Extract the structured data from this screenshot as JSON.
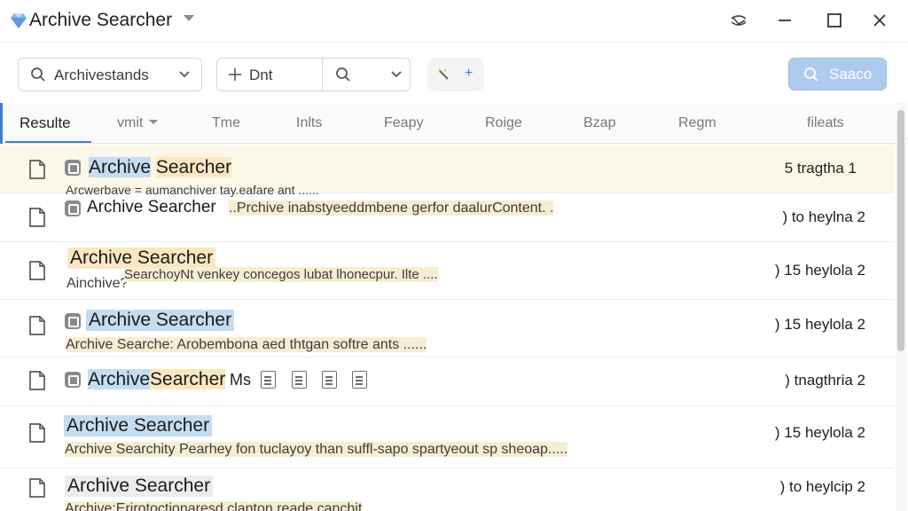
{
  "window": {
    "title": "Archive Searcher",
    "logo_icon": "diamond-logo-icon",
    "controls": [
      "sync-icon",
      "minimize-icon",
      "maximize-icon",
      "close-icon"
    ]
  },
  "toolbar": {
    "scope_field": {
      "value": "Archivestands",
      "icon": "search-icon",
      "dropdown_icon": "chevron-down-icon"
    },
    "filter_field": {
      "value": "Dnt",
      "icon": "plus-icon",
      "search_icon": "search-icon",
      "dropdown_icon": "chevron-down-icon"
    },
    "tool_chip": {
      "icon": "wand-icon",
      "plus": "+"
    },
    "search_button": {
      "label": "Saaco",
      "icon": "search-icon"
    }
  },
  "columns": [
    {
      "label": "Resulte",
      "active": true
    },
    {
      "label": "vmit",
      "dropdown": true
    },
    {
      "label": "Tme"
    },
    {
      "label": "Inlts"
    },
    {
      "label": "Feapy"
    },
    {
      "label": "Roige"
    },
    {
      "label": "Bzap"
    },
    {
      "label": "Regm"
    },
    {
      "label": "fileats"
    }
  ],
  "results": [
    {
      "title_a": "Archive",
      "title_b": "Searcher",
      "snippet": "Arcwerbave = aumanchiver tay.eafare ant ......",
      "meta": "5 tragtha 1",
      "selected": true
    },
    {
      "title": "Archive Searcher",
      "snippet": "..Prchive inabstyeeddmbene gerfor daalurContent. .",
      "meta": ") to heylna 2"
    },
    {
      "title": "Archive Searcher",
      "snippet_prefix": "Ainchive?",
      "snippet": "SearchoyNt venkey concegos lubat lhonecpur.  Ilte ....",
      "meta": ") 15 heylola 2"
    },
    {
      "title": "Archive Searcher",
      "snippet": "Archive Searche: Arobembona aed thtgan softre ants ......",
      "meta": ") 15 heylola 2"
    },
    {
      "title_a": "Archive",
      "title_b": "Searcher",
      "suffix": "Ms",
      "meta": ") tnagthria 2"
    },
    {
      "title": "Archive Searcher",
      "snippet": "Archive Searchity Pearhey fon tuclayoy than suffl-sapo spartyeout sp sheoap.....",
      "meta": ") 15 heylola 2"
    },
    {
      "title": "Archive Searcher",
      "snippet": "Archive:Erirotoctionaresd clanton  reade canchit",
      "meta": ") to heylcip 2"
    }
  ]
}
